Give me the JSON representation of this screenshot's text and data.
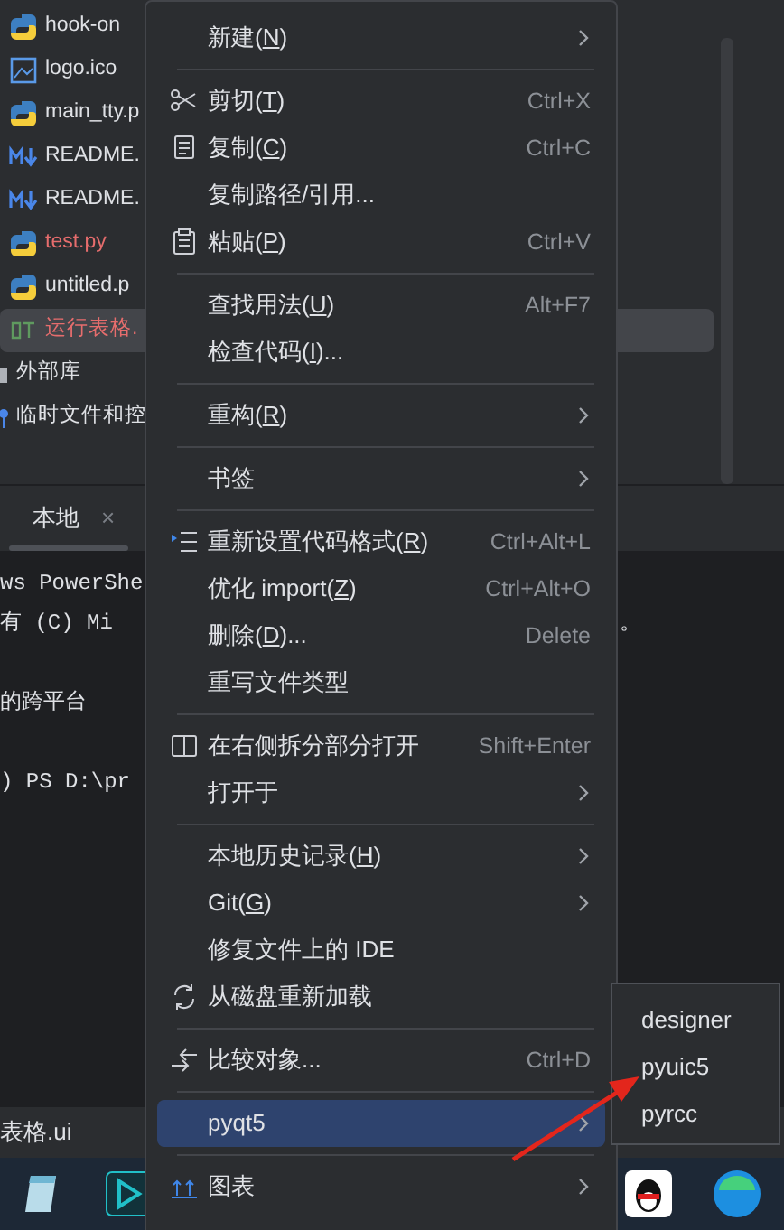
{
  "project_tree": {
    "items": [
      {
        "name": "hook-on",
        "kind": "python",
        "color": "#dfe1e5",
        "selected": false
      },
      {
        "name": "logo.ico",
        "kind": "image",
        "color": "#dfe1e5",
        "selected": false
      },
      {
        "name": "main_tty.p",
        "kind": "python",
        "color": "#dfe1e5",
        "selected": false
      },
      {
        "name": "README.",
        "kind": "markdown",
        "color": "#dfe1e5",
        "selected": false
      },
      {
        "name": "README.",
        "kind": "markdown",
        "color": "#dfe1e5",
        "selected": false
      },
      {
        "name": "test.py",
        "kind": "python",
        "color": "#e66d6d",
        "selected": false
      },
      {
        "name": "untitled.p",
        "kind": "python",
        "color": "#dfe1e5",
        "selected": false
      },
      {
        "name": "运行表格.",
        "kind": "qt",
        "color": "#e66d6d",
        "selected": true
      },
      {
        "name": "外部库",
        "kind": "library",
        "color": "#dfe1e5",
        "selected": false
      },
      {
        "name": "临时文件和控",
        "kind": "scratch",
        "color": "#dfe1e5",
        "selected": false
      }
    ]
  },
  "terminal": {
    "tab": {
      "label": "本地",
      "close": "×"
    },
    "lines": [
      {
        "kind": "text",
        "text": "ws PowerShe"
      },
      {
        "kind": "text",
        "text": "有 (C) Mi"
      },
      {
        "kind": "blank"
      },
      {
        "kind": "text",
        "text": "的跨平台"
      },
      {
        "kind": "blank"
      },
      {
        "kind": "text",
        "text": ") PS D:\\pr"
      }
    ],
    "stray_mark": "。"
  },
  "status_bar": {
    "path": "表格.ui"
  },
  "context_menu": {
    "groups": [
      [
        {
          "label": "新建(N)",
          "submenu": true,
          "selected": false
        }
      ],
      [
        {
          "label": "剪切(T)",
          "shortcut": "Ctrl+X",
          "submenu": false,
          "selected": false
        },
        {
          "label": "复制(C)",
          "shortcut": "Ctrl+C",
          "submenu": false,
          "selected": false
        },
        {
          "label": "复制路径/引用...",
          "submenu": false,
          "selected": false
        },
        {
          "label": "粘贴(P)",
          "shortcut": "Ctrl+V",
          "submenu": false,
          "selected": false
        }
      ],
      [
        {
          "label": "查找用法(U)",
          "shortcut": "Alt+F7",
          "submenu": false,
          "selected": false
        },
        {
          "label": "检查代码(I)...",
          "submenu": false,
          "selected": false
        }
      ],
      [
        {
          "label": "重构(R)",
          "submenu": true,
          "selected": false
        }
      ],
      [
        {
          "label": "书签",
          "submenu": true,
          "selected": false
        }
      ],
      [
        {
          "label": "重新设置代码格式(R)",
          "shortcut": "Ctrl+Alt+L",
          "submenu": false,
          "selected": false
        },
        {
          "label": "优化 import(Z)",
          "shortcut": "Ctrl+Alt+O",
          "submenu": false,
          "selected": false
        },
        {
          "label": "删除(D)...",
          "shortcut": "Delete",
          "submenu": false,
          "selected": false
        },
        {
          "label": "重写文件类型",
          "submenu": false,
          "selected": false
        }
      ],
      [
        {
          "label": "在右侧拆分部分打开",
          "shortcut": "Shift+Enter",
          "submenu": false,
          "selected": false
        },
        {
          "label": "打开于",
          "submenu": true,
          "selected": false
        }
      ],
      [
        {
          "label": "本地历史记录(H)",
          "submenu": true,
          "selected": false
        },
        {
          "label": "Git(G)",
          "submenu": true,
          "selected": false
        },
        {
          "label": "修复文件上的 IDE",
          "submenu": false,
          "selected": false
        },
        {
          "label": "从磁盘重新加载",
          "submenu": false,
          "selected": false
        }
      ],
      [
        {
          "label": "比较对象...",
          "shortcut": "Ctrl+D",
          "submenu": false,
          "selected": false
        }
      ],
      [
        {
          "label": "pyqt5",
          "submenu": true,
          "selected": true
        }
      ],
      [
        {
          "label": "图表",
          "submenu": true,
          "selected": false
        }
      ]
    ]
  },
  "submenu": {
    "items": [
      {
        "label": "designer"
      },
      {
        "label": "pyuic5"
      },
      {
        "label": "pyrcc"
      }
    ]
  }
}
